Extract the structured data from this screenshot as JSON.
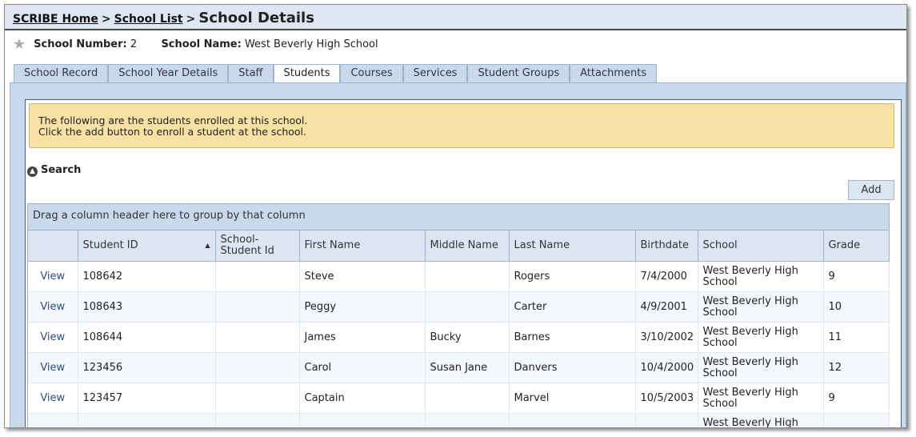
{
  "breadcrumb": {
    "home": "SCRIBE Home",
    "sep1": ">",
    "list": "School List",
    "sep2": ">",
    "current": "School Details"
  },
  "school_info": {
    "star_icon": "star-icon",
    "number_label": "School Number:",
    "number_value": "2",
    "name_label": "School Name:",
    "name_value": "West Beverly High School"
  },
  "tabs": [
    "School Record",
    "School Year Details",
    "Staff",
    "Students",
    "Courses",
    "Services",
    "Student Groups",
    "Attachments"
  ],
  "active_tab": "Students",
  "notice": {
    "line1": "The following are the students enrolled at this school.",
    "line2": "Click the add button to enroll a student at the school."
  },
  "search": {
    "label": "Search",
    "icon": "collapse-circle-icon"
  },
  "add_button": "Add",
  "grid": {
    "group_hint": "Drag a column header here to group by that column",
    "columns": [
      "",
      "Student ID",
      "School-Student Id",
      "First Name",
      "Middle Name",
      "Last Name",
      "Birthdate",
      "School",
      "Grade"
    ],
    "sort_indicator": "▲",
    "view_label": "View",
    "rows": [
      {
        "id": "108642",
        "ssid": "",
        "first": "Steve",
        "middle": "",
        "last": "Rogers",
        "birth": "7/4/2000",
        "school": "West Beverly High School",
        "grade": "9"
      },
      {
        "id": "108643",
        "ssid": "",
        "first": "Peggy",
        "middle": "",
        "last": "Carter",
        "birth": "4/9/2001",
        "school": "West Beverly High School",
        "grade": "10"
      },
      {
        "id": "108644",
        "ssid": "",
        "first": "James",
        "middle": "Bucky",
        "last": "Barnes",
        "birth": "3/10/2002",
        "school": "West Beverly High School",
        "grade": "11"
      },
      {
        "id": "123456",
        "ssid": "",
        "first": "Carol",
        "middle": "Susan Jane",
        "last": "Danvers",
        "birth": "10/4/2000",
        "school": "West Beverly High School",
        "grade": "12"
      },
      {
        "id": "123457",
        "ssid": "",
        "first": "Captain",
        "middle": "",
        "last": "Marvel",
        "birth": "10/5/2003",
        "school": "West Beverly High School",
        "grade": "9"
      },
      {
        "id": "",
        "ssid": "",
        "first": "",
        "middle": "",
        "last": "",
        "birth": "",
        "school": "West Beverly High School",
        "grade": ""
      }
    ]
  }
}
